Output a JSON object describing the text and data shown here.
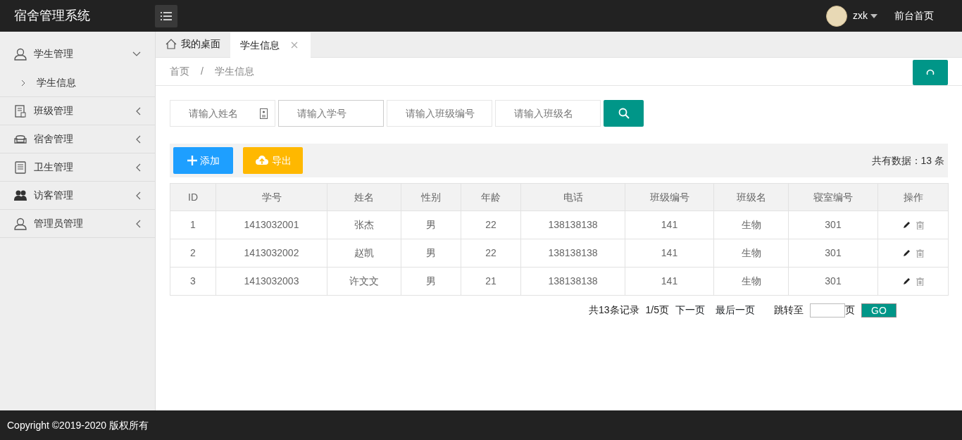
{
  "header": {
    "title": "宿舍管理系统",
    "user": "zxk",
    "link": "前台首页"
  },
  "sidebar": {
    "items": [
      {
        "label": "学生管理",
        "kind": "user",
        "expanded": true,
        "children": [
          {
            "label": "学生信息"
          }
        ]
      },
      {
        "label": "班级管理",
        "kind": "doc",
        "expanded": false
      },
      {
        "label": "宿舍管理",
        "kind": "sofa",
        "expanded": false
      },
      {
        "label": "卫生管理",
        "kind": "note",
        "expanded": false
      },
      {
        "label": "访客管理",
        "kind": "group",
        "expanded": false
      },
      {
        "label": "管理员管理",
        "kind": "user",
        "expanded": false
      }
    ]
  },
  "tabs": [
    {
      "label": "我的桌面",
      "kind": "home",
      "selected": false
    },
    {
      "label": "学生信息",
      "kind": "closable",
      "selected": true
    }
  ],
  "breadcrumb": {
    "items": [
      "首页",
      "学生信息"
    ],
    "separator": "/"
  },
  "filters": [
    {
      "placeholder": "请输入姓名",
      "kind": "card"
    },
    {
      "placeholder": "请输入学号",
      "kind": "plain"
    },
    {
      "placeholder": "请输入班级编号",
      "kind": "plain"
    },
    {
      "placeholder": "请输入班级名",
      "kind": "plain"
    }
  ],
  "toolbar": {
    "buttons": [
      {
        "label": "添加",
        "kind": "add"
      },
      {
        "label": "导出",
        "kind": "export"
      }
    ],
    "total": "共有数据：13 条"
  },
  "table": {
    "columns": [
      "ID",
      "学号",
      "姓名",
      "性别",
      "年龄",
      "电话",
      "班级编号",
      "班级名",
      "寝室编号",
      "操作"
    ],
    "rows": [
      [
        "1",
        "1413032001",
        "张杰",
        "男",
        "22",
        "138138138",
        "141",
        "生物",
        "301"
      ],
      [
        "2",
        "1413032002",
        "赵凯",
        "男",
        "22",
        "138138138",
        "141",
        "生物",
        "301"
      ],
      [
        "3",
        "1413032003",
        "许文文",
        "男",
        "21",
        "138138138",
        "141",
        "生物",
        "301"
      ]
    ]
  },
  "pagination": {
    "summary": "共13条记录",
    "page": "1/5页",
    "next": "下一页",
    "last": "最后一页",
    "jump_label": "跳转至",
    "unit": "页",
    "go": "GO"
  },
  "footer": "Copyright ©2019-2020 版权所有"
}
